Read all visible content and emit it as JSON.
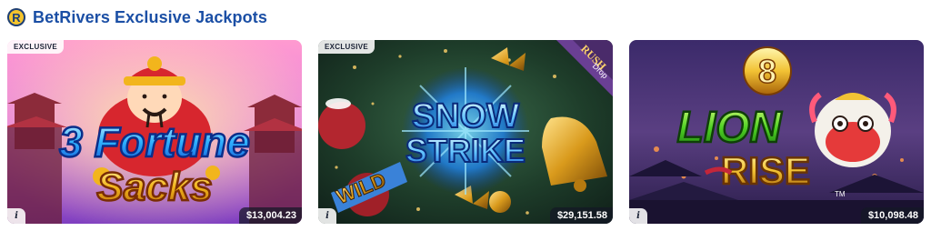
{
  "header": {
    "logo_letter": "R",
    "title": "BetRivers Exclusive Jackpots"
  },
  "games": [
    {
      "badge": "EXCLUSIVE",
      "title_line1": "3 Fortune",
      "title_line2": "Sacks",
      "info": "i",
      "jackpot": "$13,004.23"
    },
    {
      "badge": "EXCLUSIVE",
      "title_line1": "SNOW",
      "title_line2": "STRIKE",
      "ribbon_top": "RUSH",
      "ribbon_bottom": "Drop",
      "wild": "WILD",
      "info": "i",
      "jackpot": "$29,151.58"
    },
    {
      "title_num": "8",
      "title_line1": "LION",
      "title_line2": "RISE",
      "tm": "TM",
      "info": "i",
      "jackpot": "$10,098.48"
    }
  ]
}
